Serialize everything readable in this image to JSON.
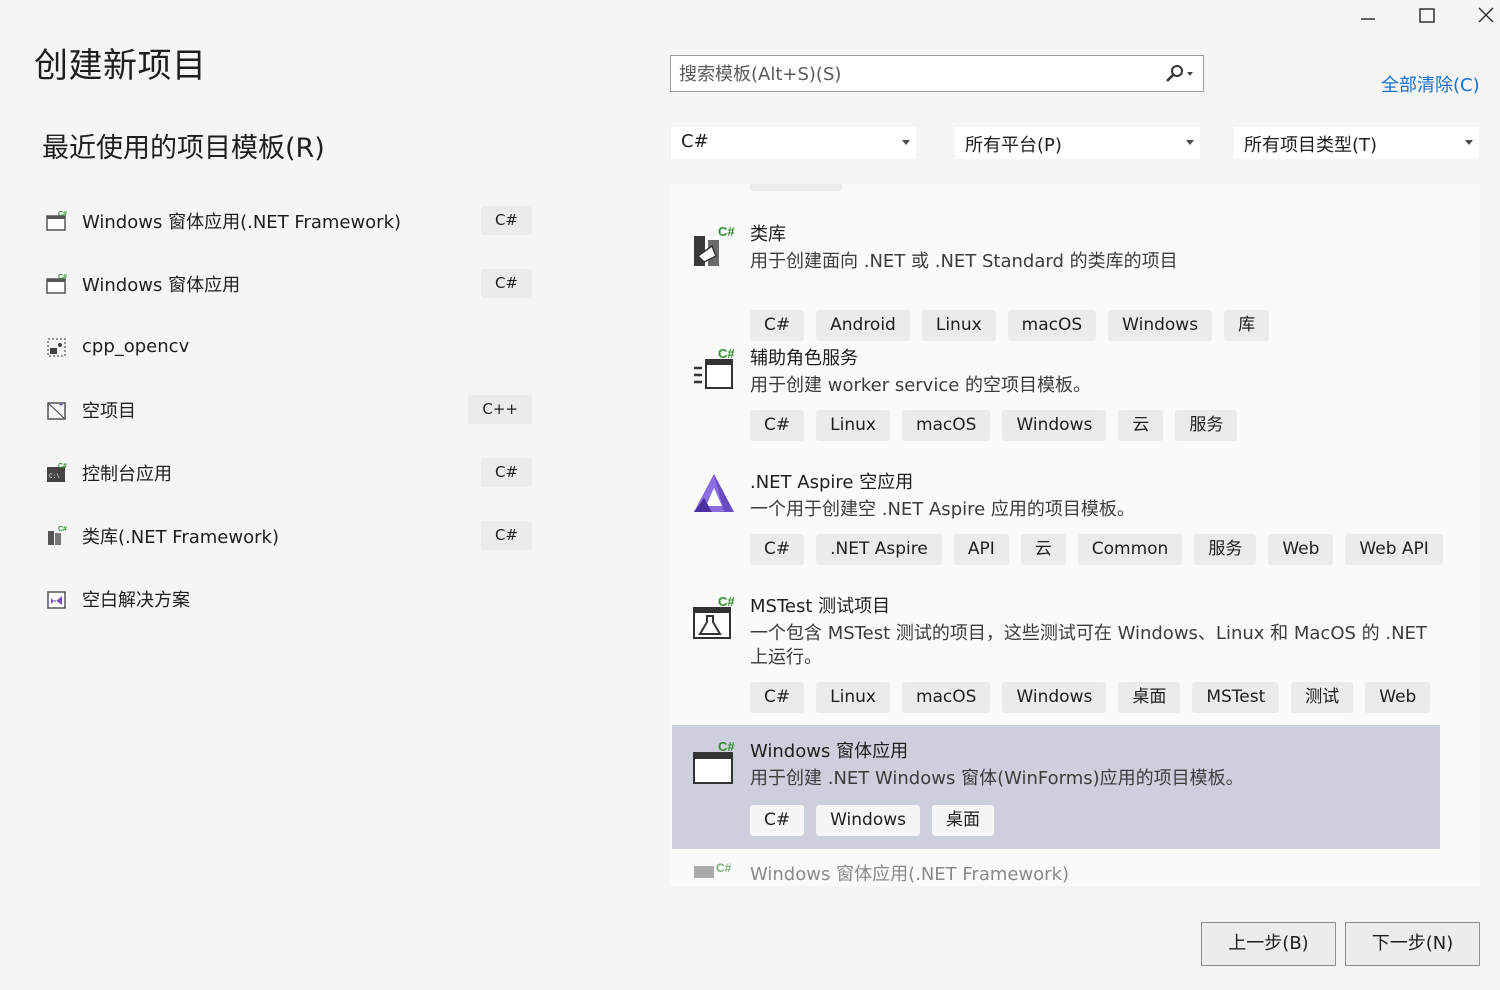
{
  "window": {
    "minimize": "minimize",
    "maximize": "maximize",
    "close": "close"
  },
  "page_title": "创建新项目",
  "recent": {
    "title": "最近使用的项目模板(R)",
    "items": [
      {
        "label": "Windows 窗体应用(.NET Framework)",
        "lang": "C#",
        "icon": "winforms-framework-icon"
      },
      {
        "label": "Windows 窗体应用",
        "lang": "C#",
        "icon": "winforms-icon"
      },
      {
        "label": "cpp_opencv",
        "lang": "",
        "icon": "custom-template-icon"
      },
      {
        "label": "空项目",
        "lang": "C++",
        "icon": "empty-project-icon"
      },
      {
        "label": "控制台应用",
        "lang": "C#",
        "icon": "console-app-icon"
      },
      {
        "label": "类库(.NET Framework)",
        "lang": "C#",
        "icon": "class-library-icon"
      },
      {
        "label": "空白解决方案",
        "lang": "",
        "icon": "blank-solution-icon"
      }
    ]
  },
  "search": {
    "placeholder": "搜索模板(Alt+S)(S)",
    "value": ""
  },
  "clear_all": "全部清除(C)",
  "filters": {
    "language": "C#",
    "platform": "所有平台(P)",
    "project_type": "所有项目类型(T)"
  },
  "templates": [
    {
      "name": "类库",
      "desc": "用于创建面向 .NET 或 .NET Standard 的类库的项目",
      "tags": [
        "C#",
        "Android",
        "Linux",
        "macOS",
        "Windows",
        "库"
      ],
      "icon": "class-library-icon"
    },
    {
      "name": "辅助角色服务",
      "desc": "用于创建 worker service 的空项目模板。",
      "tags": [
        "C#",
        "Linux",
        "macOS",
        "Windows",
        "云",
        "服务"
      ],
      "icon": "worker-service-icon"
    },
    {
      "name": ".NET Aspire 空应用",
      "desc": "一个用于创建空 .NET Aspire 应用的项目模板。",
      "tags": [
        "C#",
        ".NET Aspire",
        "API",
        "云",
        "Common",
        "服务",
        "Web",
        "Web API"
      ],
      "icon": "aspire-icon"
    },
    {
      "name": "MSTest 测试项目",
      "desc": "一个包含 MSTest 测试的项目，这些测试可在 Windows、Linux 和 MacOS 的 .NET 上运行。",
      "tags": [
        "C#",
        "Linux",
        "macOS",
        "Windows",
        "桌面",
        "MSTest",
        "测试",
        "Web"
      ],
      "icon": "mstest-icon"
    },
    {
      "name": "Windows 窗体应用",
      "desc": "用于创建 .NET Windows 窗体(WinForms)应用的项目模板。",
      "tags": [
        "C#",
        "Windows",
        "桌面"
      ],
      "icon": "winforms-icon",
      "selected": true
    }
  ],
  "partial_template": "Windows 窗体应用(.NET Framework)",
  "buttons": {
    "back": "上一步(B)",
    "next": "下一步(N)"
  },
  "colors": {
    "accent_link": "#1a6fc9",
    "selected_bg": "#cdd0dc",
    "csharp_green": "#388a34",
    "aspire_purple": "#6a4bc4"
  }
}
